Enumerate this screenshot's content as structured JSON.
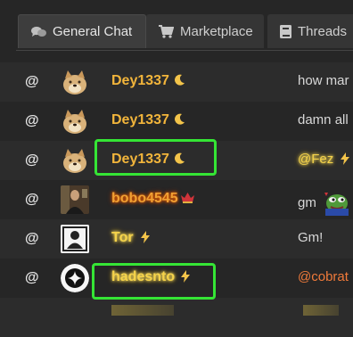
{
  "tabs": [
    {
      "label": "General Chat",
      "icon": "chat-bubbles-icon",
      "active": true
    },
    {
      "label": "Marketplace",
      "icon": "cart-icon",
      "active": false
    },
    {
      "label": "Threads",
      "icon": "book-icon",
      "active": false
    }
  ],
  "messages": [
    {
      "at": "@",
      "user": "Dey1337",
      "avatar": "doge-avatar",
      "badge": "moon-icon",
      "text": "how mar"
    },
    {
      "at": "@",
      "user": "Dey1337",
      "avatar": "doge-avatar",
      "badge": "moon-icon",
      "text": "damn all"
    },
    {
      "at": "@",
      "user": "Dey1337",
      "avatar": "doge-avatar",
      "badge": "moon-icon",
      "mention": "@Fez",
      "text": ""
    },
    {
      "at": "@",
      "user": "bobo4545",
      "avatar": "photo-avatar",
      "badge": "crown-icon",
      "text": "gm"
    },
    {
      "at": "@",
      "user": "Tor",
      "avatar": "person-silhouette-avatar",
      "badge": "lightning-icon",
      "text": "Gm!"
    },
    {
      "at": "@",
      "user": "hadesnto",
      "avatar": "sparkle-avatar",
      "badge": "lightning-icon",
      "mention": "@cobrat",
      "text": ""
    }
  ],
  "colors": {
    "highlight": "#35e535",
    "gold_name": "#f2b53b",
    "accent_mention": "#f07a3a"
  }
}
